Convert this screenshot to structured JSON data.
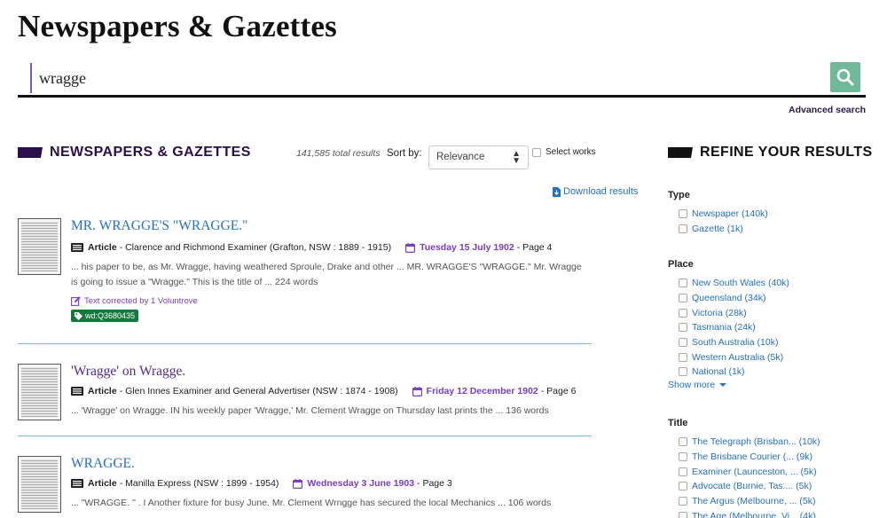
{
  "page": {
    "title": "Newspapers & Gazettes"
  },
  "search": {
    "query": "wragge",
    "advanced_label": "Advanced search"
  },
  "results_header": {
    "heading": "NEWSPAPERS & GAZETTES",
    "total": "141,585 total results",
    "sort_label": "Sort by:",
    "sort_value": "Relevance",
    "select_works_label": "Select works",
    "download_label": "Download results"
  },
  "results": [
    {
      "title": "MR. WRAGGE'S \"WRAGGE.\"",
      "type": "Article",
      "source": "- Clarence and Richmond Examiner (Grafton, NSW : 1889 - 1915)",
      "date": "Tuesday 15 July 1902",
      "page": "- Page 4",
      "snippet_line1": "... his paper to be, as Mr.  Wragge, having weathered Sproule, Drake  and other ... MR. WRAGGE'S \"WRAGGE.\"  Mr. Wragge",
      "snippet_line2": "is going to issue a \"Wragge.\"  This is the title of ... 224 words",
      "corrected": "Text corrected by 1 Voluntrove",
      "tag": "wd:Q3680435"
    },
    {
      "title": "'Wragge' on Wragge.",
      "type": "Article",
      "source": "- Glen Innes Examiner and General Advertiser (NSW : 1874 - 1908)",
      "date": "Friday 12 December 1902",
      "page": "- Page 6",
      "snippet_line1": "... 'Wragge' on Wragge. IN his weekly paper 'Wragge,' Mr. Clement Wragge on Thursday last prints the ... 136 words"
    },
    {
      "title": "WRAGGE.",
      "type": "Article",
      "source": "- Manilla Express (NSW : 1899 - 1954)",
      "date": "Wednesday 3 June 1903",
      "page": "- Page 3",
      "snippet_line1": "... \"WRAGGE. \" . I Another fixture for busy June. Mr. Clement Wrngge has secured the local Mechanics ... 106 words"
    }
  ],
  "refine": {
    "heading": "REFINE YOUR RESULTS",
    "type": {
      "title": "Type",
      "items": [
        "Newspaper (140k)",
        "Gazette (1k)"
      ]
    },
    "place": {
      "title": "Place",
      "items": [
        "New South Wales (40k)",
        "Queensland (34k)",
        "Victoria (28k)",
        "Tasmania (24k)",
        "South Australia (10k)",
        "Western Australia (5k)",
        "National (1k)"
      ],
      "show_more": "Show more"
    },
    "title_facet": {
      "title": "Title",
      "items": [
        "The Telegraph (Brisban... (10k)",
        "The Brisbane Courier (... (9k)",
        "Examiner (Launceston, ... (5k)",
        "Advocate (Burnie, Tas.... (5k)",
        "The Argus (Melbourne, ... (5k)",
        "The Age (Melbourne, Vi... (4k)"
      ]
    }
  },
  "colors": {
    "accent_purple": "#2a0f4a",
    "link_blue": "#2571c1",
    "search_green": "#6fb898",
    "tag_green": "#137a3d",
    "divider": "#7fc3cf"
  }
}
